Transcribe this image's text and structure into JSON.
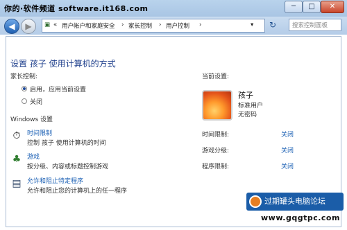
{
  "watermark": "你的·软件频道 software.it168.com",
  "window_buttons": [
    "─",
    "□",
    "✕"
  ],
  "address": {
    "lead": "«",
    "crumbs": [
      "用户帐户和家庭安全",
      "家长控制",
      "用户控制"
    ],
    "refresh_icon": "↻",
    "search_placeholder": "搜索控制面板"
  },
  "main": {
    "title": "设置 孩子 使用计算机的方式",
    "parental_label": "家长控制:",
    "option_on": "启用，应用当前设置",
    "option_off": "关闭",
    "selected": "on",
    "windows_settings_label": "Windows 设置",
    "features": [
      {
        "link": "时间限制",
        "desc": "控制 孩子 使用计算机的时间",
        "icon": "clock-icon"
      },
      {
        "link": "游戏",
        "desc": "按分级、内容或标题控制游戏",
        "icon": "game-icon"
      },
      {
        "link": "允许和阻止特定程序",
        "desc": "允许和阻止您的计算机上的任一程序",
        "icon": "program-icon"
      }
    ]
  },
  "current": {
    "label": "当前设置:",
    "user_name": "孩子",
    "user_type": "标准用户",
    "password": "无密码",
    "rows": [
      {
        "label": "时间限制:",
        "value": "关闭"
      },
      {
        "label": "游戏分级:",
        "value": "关闭"
      },
      {
        "label": "程序限制:",
        "value": "关闭"
      }
    ]
  },
  "footer": {
    "logo_text": "过期罐头电脑论坛",
    "url": "www.gqgtpc.com"
  },
  "colors": {
    "link": "#1a5fb4",
    "title": "#1e3f8c",
    "titlebar": "#b9d3ec"
  }
}
